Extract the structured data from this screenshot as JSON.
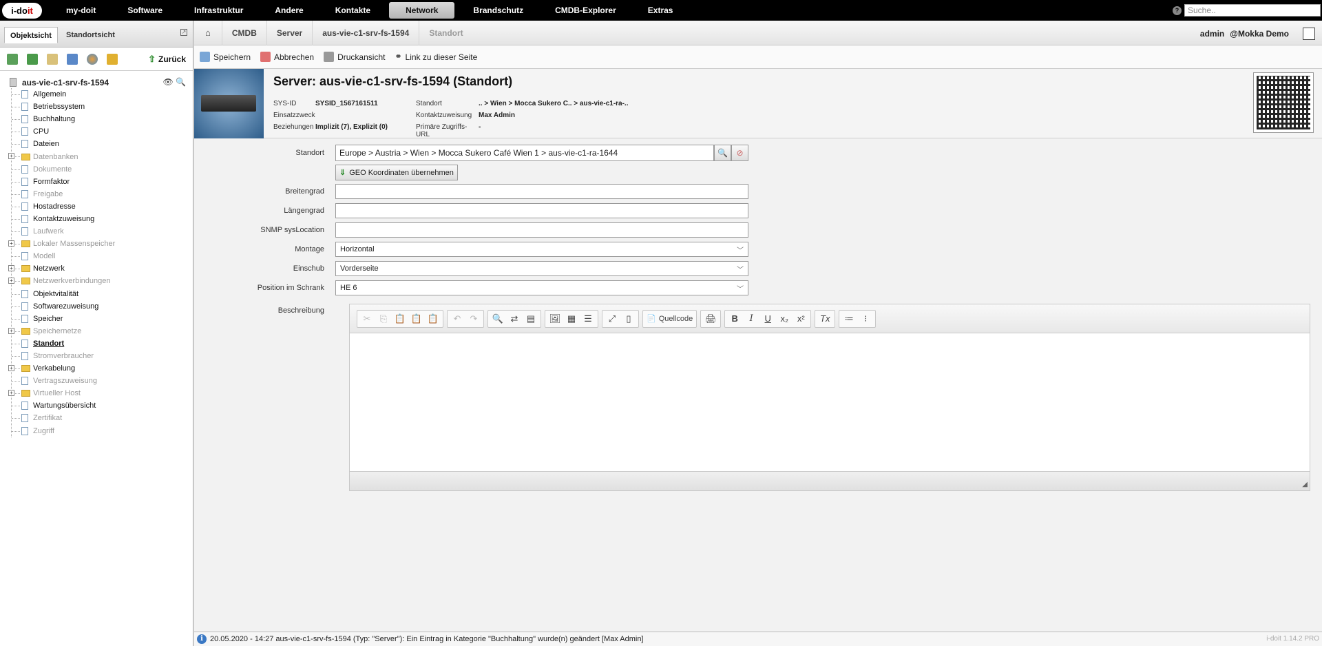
{
  "brand": {
    "name_prefix": "i-do",
    "name_suffix": "it"
  },
  "topnav": [
    "my-doit",
    "Software",
    "Infrastruktur",
    "Andere",
    "Kontakte",
    "Network",
    "Brandschutz",
    "CMDB-Explorer",
    "Extras"
  ],
  "topnav_active": "Network",
  "search": {
    "placeholder": "Suche.."
  },
  "sidebar": {
    "tabs": [
      "Objektsicht",
      "Standortsicht"
    ],
    "back_label": "Zurück",
    "root": "aus-vie-c1-srv-fs-1594",
    "items": [
      {
        "label": "Allgemein",
        "type": "doc",
        "state": "normal"
      },
      {
        "label": "Betriebssystem",
        "type": "doc",
        "state": "normal"
      },
      {
        "label": "Buchhaltung",
        "type": "doc",
        "state": "normal"
      },
      {
        "label": "CPU",
        "type": "doc",
        "state": "normal"
      },
      {
        "label": "Dateien",
        "type": "doc",
        "state": "normal"
      },
      {
        "label": "Datenbanken",
        "type": "folder",
        "state": "disabled"
      },
      {
        "label": "Dokumente",
        "type": "doc",
        "state": "disabled"
      },
      {
        "label": "Formfaktor",
        "type": "doc",
        "state": "normal"
      },
      {
        "label": "Freigabe",
        "type": "doc",
        "state": "disabled"
      },
      {
        "label": "Hostadresse",
        "type": "doc",
        "state": "normal"
      },
      {
        "label": "Kontaktzuweisung",
        "type": "doc",
        "state": "normal"
      },
      {
        "label": "Laufwerk",
        "type": "doc",
        "state": "disabled"
      },
      {
        "label": "Lokaler Massenspeicher",
        "type": "folder",
        "state": "disabled"
      },
      {
        "label": "Modell",
        "type": "doc",
        "state": "disabled"
      },
      {
        "label": "Netzwerk",
        "type": "folder",
        "state": "normal"
      },
      {
        "label": "Netzwerkverbindungen",
        "type": "folder",
        "state": "disabled"
      },
      {
        "label": "Objektvitalität",
        "type": "doc",
        "state": "normal"
      },
      {
        "label": "Softwarezuweisung",
        "type": "doc",
        "state": "normal"
      },
      {
        "label": "Speicher",
        "type": "doc",
        "state": "normal"
      },
      {
        "label": "Speichernetze",
        "type": "folder",
        "state": "disabled"
      },
      {
        "label": "Standort",
        "type": "doc",
        "state": "active"
      },
      {
        "label": "Stromverbraucher",
        "type": "doc",
        "state": "disabled"
      },
      {
        "label": "Verkabelung",
        "type": "folder",
        "state": "normal"
      },
      {
        "label": "Vertragszuweisung",
        "type": "doc",
        "state": "disabled"
      },
      {
        "label": "Virtueller Host",
        "type": "folder",
        "state": "disabled"
      },
      {
        "label": "Wartungsübersicht",
        "type": "doc",
        "state": "normal"
      },
      {
        "label": "Zertifikat",
        "type": "doc",
        "state": "disabled"
      },
      {
        "label": "Zugriff",
        "type": "doc",
        "state": "disabled"
      }
    ]
  },
  "breadcrumb": {
    "items": [
      "CMDB",
      "Server",
      "aus-vie-c1-srv-fs-1594"
    ],
    "current": "Standort"
  },
  "user": {
    "name": "admin",
    "tenant": "@Mokka Demo"
  },
  "actions": {
    "save": "Speichern",
    "cancel": "Abbrechen",
    "print": "Druckansicht",
    "link": "Link zu dieser Seite"
  },
  "object": {
    "title": "Server: aus-vie-c1-srv-fs-1594 (Standort)",
    "sysid_label": "SYS-ID",
    "sysid": "SYSID_1567161511",
    "purpose_label": "Einsatzzweck",
    "purpose": "",
    "relations_label": "Beziehungen",
    "relations": "Implizit (7), Explizit (0)",
    "location_label": "Standort",
    "location": ".. > Wien > Mocca Sukero C.. > aus-vie-c1-ra-..",
    "contact_label": "Kontaktzuweisung",
    "contact": "Max Admin",
    "url_label": "Primäre Zugriffs-URL",
    "url": "-"
  },
  "form": {
    "location_label": "Standort",
    "location_value": "Europe > Austria > Wien > Mocca Sukero Café Wien 1 > aus-vie-c1-ra-1644",
    "geo_button": "GEO Koordinaten übernehmen",
    "latitude_label": "Breitengrad",
    "latitude": "",
    "longitude_label": "Längengrad",
    "longitude": "",
    "snmp_label": "SNMP sysLocation",
    "snmp": "",
    "mount_label": "Montage",
    "mount": "Horizontal",
    "insertion_label": "Einschub",
    "insertion": "Vorderseite",
    "position_label": "Position im Schrank",
    "position": "HE 6",
    "description_label": "Beschreibung",
    "source_label": "Quellcode"
  },
  "status": {
    "message": "20.05.2020 - 14:27 aus-vie-c1-srv-fs-1594 (Typ: \"Server\"): Ein Eintrag in Kategorie \"Buchhaltung\" wurde(n) geändert [Max Admin]",
    "version": "i-doit 1.14.2 PRO"
  }
}
